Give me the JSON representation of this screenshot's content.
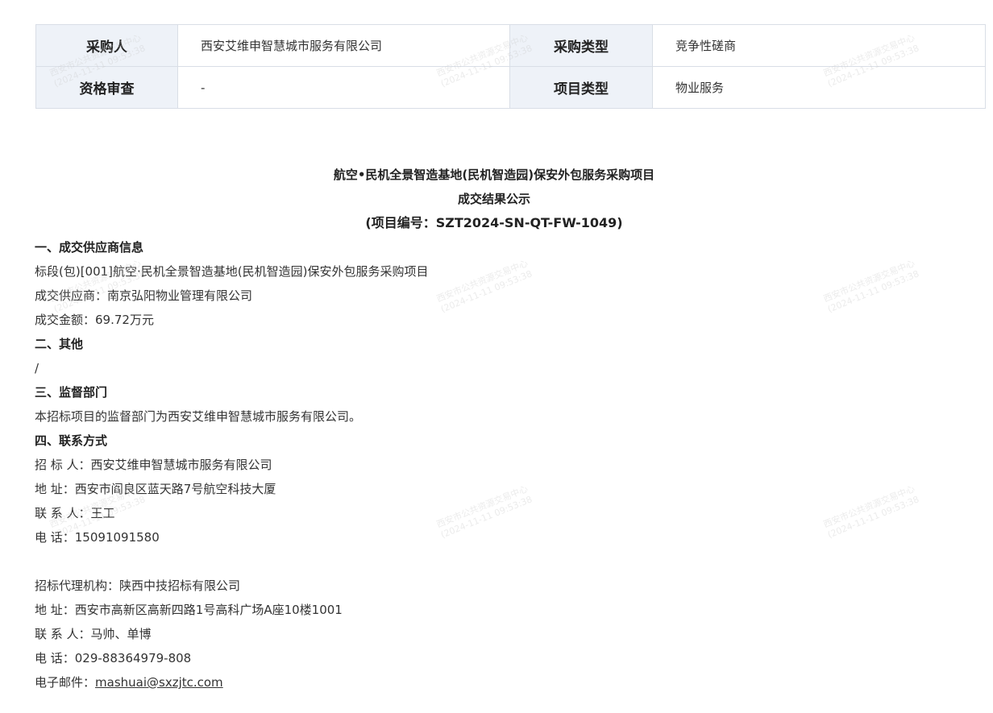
{
  "info_table": {
    "rows": [
      {
        "label1": "采购人",
        "value1": "西安艾维申智慧城市服务有限公司",
        "label2": "采购类型",
        "value2": "竞争性磋商"
      },
      {
        "label1": "资格审查",
        "value1": "-",
        "label2": "项目类型",
        "value2": "物业服务"
      }
    ]
  },
  "notice": {
    "title_line1": "航空•民机全景智造基地(民机智造园)保安外包服务采购项目",
    "title_line2": "成交结果公示",
    "project_no": "(项目编号：SZT2024-SN-QT-FW-1049)",
    "sec1_heading": "一、成交供应商信息",
    "lot": "标段(包)[001]航空·民机全景智造基地(民机智造园)保安外包服务采购项目",
    "supplier": "成交供应商：南京弘阳物业管理有限公司",
    "amount": "成交金额：69.72万元",
    "sec2_heading": "二、其他",
    "sec2_body": "/",
    "sec3_heading": "三、监督部门",
    "sec3_body": "本招标项目的监督部门为西安艾维申智慧城市服务有限公司。",
    "sec4_heading": "四、联系方式",
    "tenderer": "招 标 人：西安艾维申智慧城市服务有限公司",
    "tenderer_address": "地 址：西安市阎良区蓝天路7号航空科技大厦",
    "tenderer_contact": "联 系 人：王工",
    "tenderer_phone": "电 话：15091091580",
    "agency": "招标代理机构：陕西中技招标有限公司",
    "agency_address": "地 址：西安市高新区高新四路1号高科广场A座10楼1001",
    "agency_contact": "联 系 人：马帅、单博",
    "agency_phone": "电 话：029-88364979-808",
    "email_label": "电子邮件：",
    "email": "mashuai@sxzjtc.com"
  },
  "watermark": {
    "line1": "西安市公共资源交易中心",
    "line2": "(2024-11-11 09:53:38"
  }
}
